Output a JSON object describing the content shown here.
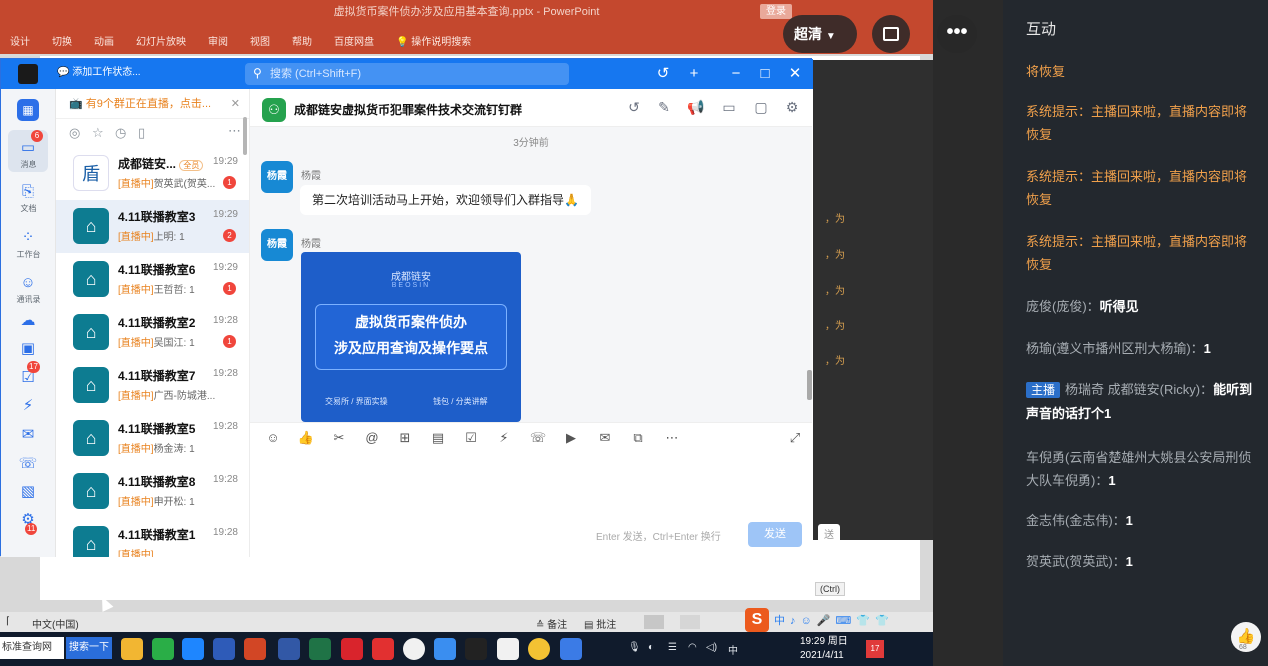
{
  "ppt": {
    "title": "虚拟货币案件侦办涉及应用基本查询.pptx - PowerPoint",
    "login": "登录",
    "ribbon": [
      "设计",
      "切换",
      "动画",
      "幻灯片放映",
      "审阅",
      "视图",
      "帮助",
      "百度网盘",
      "操作说明搜索"
    ],
    "status_left": "中文(中国)",
    "status_notes": "备注",
    "status_comments": "批注",
    "ctrl_tag": "(Ctrl)",
    "behind_text": [
      "，为",
      "，为",
      "，为",
      "，为",
      "，为"
    ]
  },
  "overlay": {
    "quality": "超清",
    "more": "•••"
  },
  "taskbar": {
    "search_site": "标准查询网",
    "search_btn": "搜索一下",
    "time": "19:29 周日",
    "date": "2021/4/11",
    "ime": "中",
    "notif": "17"
  },
  "dingtalk": {
    "status": "添加工作状态...",
    "search_placeholder": "搜索 (Ctrl+Shift+F)",
    "nav": [
      {
        "label": "消息",
        "badge": "6"
      },
      {
        "label": "文档"
      },
      {
        "label": "工作台"
      },
      {
        "label": "通讯录"
      },
      {
        "label": ""
      },
      {
        "label": ""
      },
      {
        "label": "",
        "badge": "17"
      },
      {
        "label": ""
      },
      {
        "label": ""
      },
      {
        "label": ""
      },
      {
        "label": ""
      },
      {
        "label": "",
        "badge": "11"
      }
    ],
    "live_banner": "有9个群正在直播，点击...",
    "conversations": [
      {
        "name": "成都链安...",
        "tag": "全员",
        "time": "19:29",
        "live": "[直播中]",
        "sub": "贺英武(贺英...",
        "badge": "1",
        "av": "盾"
      },
      {
        "name": "4.11联播教室3",
        "time": "19:29",
        "live": "[直播中]",
        "sub": "上明: 1",
        "badge": "2",
        "av": "⌂"
      },
      {
        "name": "4.11联播教室6",
        "time": "19:29",
        "live": "[直播中]",
        "sub": "王哲哲: 1",
        "badge": "1",
        "av": "⌂"
      },
      {
        "name": "4.11联播教室2",
        "time": "19:28",
        "live": "[直播中]",
        "sub": "吴国江: 1",
        "badge": "1",
        "av": "⌂"
      },
      {
        "name": "4.11联播教室7",
        "time": "19:28",
        "live": "[直播中]",
        "sub": "广西-防城港...",
        "badge": "",
        "av": "⌂"
      },
      {
        "name": "4.11联播教室5",
        "time": "19:28",
        "live": "[直播中]",
        "sub": "杨金涛: 1",
        "badge": "",
        "av": "⌂"
      },
      {
        "name": "4.11联播教室8",
        "time": "19:28",
        "live": "[直播中]",
        "sub": "申开松: 1",
        "badge": "",
        "av": "⌂"
      },
      {
        "name": "4.11联播教室1",
        "time": "19:28",
        "live": "[直播中]",
        "sub": "",
        "badge": "",
        "av": "⌂"
      }
    ],
    "chat": {
      "title": "成都链安虚拟货币犯罪案件技术交流钉钉群",
      "time_divider": "3分钟前",
      "sender1": "杨霞",
      "avatar1": "杨霞",
      "msg1": "第二次培训活动马上开始，欢迎领导们入群指导🙏",
      "sender2": "杨霞",
      "avatar2": "杨霞",
      "card": {
        "logo": "成都链安",
        "logo_en": "BEOSIN",
        "line1": "虚拟货币案件侦办",
        "line2": "涉及应用查询及操作要点",
        "tag1": "交易所 / 界面实操",
        "tag2": "钱包 / 分类讲解"
      },
      "send_hint": "Enter 发送，Ctrl+Enter 换行",
      "send_label": "发送"
    }
  },
  "side": {
    "title": "互动",
    "messages": [
      {
        "orange": "将恢复"
      },
      {
        "orange": "系统提示：主播回来啦，直播内容即将恢复"
      },
      {
        "orange": "系统提示：主播回来啦，直播内容即将恢复"
      },
      {
        "orange": "系统提示：主播回来啦，直播内容即将恢复"
      },
      {
        "grey": "庞俊(庞俊)：",
        "white": "听得见"
      },
      {
        "grey": "杨瑜(遵义市播州区刑大杨瑜)：",
        "white": "1"
      },
      {
        "host": "主播",
        "grey": "杨瑞奇 成都链安(Ricky)：",
        "white": "能听到声音的话打个1"
      },
      {
        "grey": "车倪勇(云南省楚雄州大姚县公安局刑侦大队车倪勇)：",
        "white": "1"
      },
      {
        "grey": "金志伟(金志伟)：",
        "white": "1"
      },
      {
        "grey": "贺英武(贺英武)：",
        "white": "1"
      }
    ],
    "like_count": "68"
  }
}
